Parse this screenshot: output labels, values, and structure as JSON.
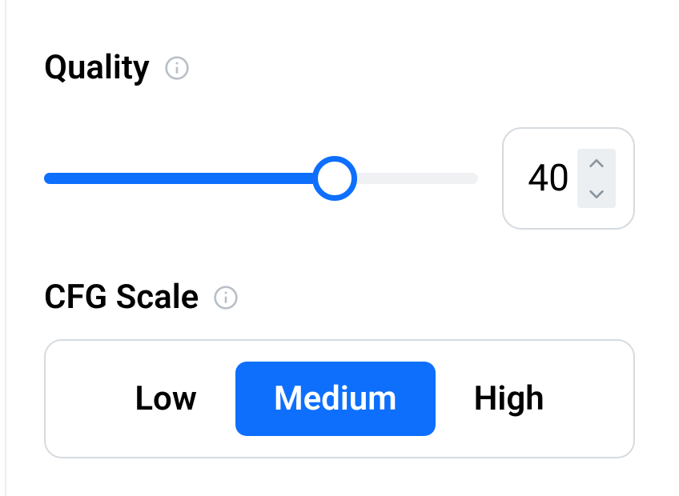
{
  "quality": {
    "label": "Quality",
    "value": "40",
    "min": 0,
    "max": 60,
    "fill_percent": 67
  },
  "cfg": {
    "label": "CFG Scale",
    "options": [
      "Low",
      "Medium",
      "High"
    ],
    "selected_index": 1
  }
}
